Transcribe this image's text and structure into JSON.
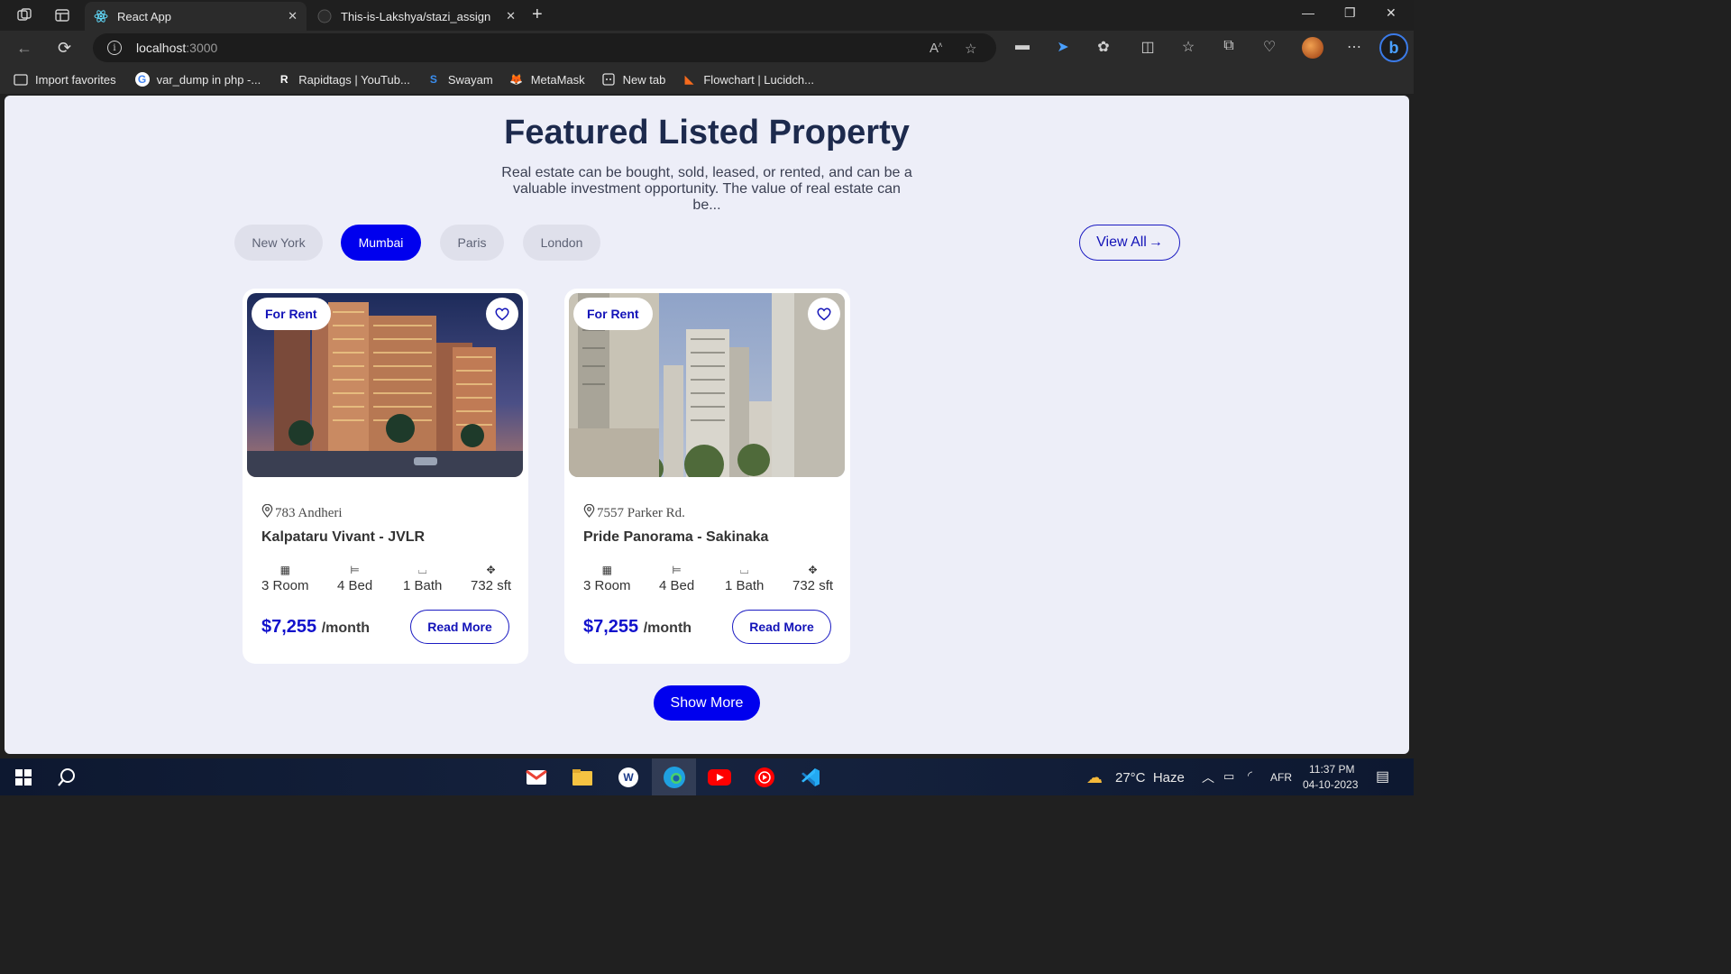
{
  "browser": {
    "tabs": [
      {
        "title": "React App"
      },
      {
        "title": "This-is-Lakshya/stazi_assign"
      }
    ],
    "url_host": "localhost",
    "url_port": ":3000",
    "favorites": [
      {
        "label": "Import favorites",
        "icon": "folder-icon"
      },
      {
        "label": "var_dump in php -...",
        "icon": "google-icon"
      },
      {
        "label": "Rapidtags | YouTub...",
        "icon": "rapidtags-icon"
      },
      {
        "label": "Swayam",
        "icon": "swayam-icon"
      },
      {
        "label": "MetaMask",
        "icon": "metamask-icon"
      },
      {
        "label": "New tab",
        "icon": "newtab-icon"
      },
      {
        "label": "Flowchart | Lucidch...",
        "icon": "lucid-icon"
      }
    ]
  },
  "page": {
    "title": "Featured Listed Property",
    "subtitle": "Real estate can be bought, sold, leased, or rented, and can be a valuable investment opportunity. The value of real estate can be...",
    "cities": [
      "New York",
      "Mumbai",
      "Paris",
      "London"
    ],
    "active_city": "Mumbai",
    "view_all": "View All",
    "show_more": "Show More",
    "listings": [
      {
        "tag": "For Rent",
        "address": "783 Andheri",
        "name": "Kalpataru Vivant - JVLR",
        "rooms": "3 Room",
        "beds": "4 Bed",
        "baths": "1 Bath",
        "area": "732 sft",
        "price": "$7,255",
        "per": "/month",
        "cta": "Read More"
      },
      {
        "tag": "For Rent",
        "address": "7557 Parker Rd.",
        "name": "Pride Panorama - Sakinaka",
        "rooms": "3 Room",
        "beds": "4 Bed",
        "baths": "1 Bath",
        "area": "732 sft",
        "price": "$7,255",
        "per": "/month",
        "cta": "Read More"
      }
    ]
  },
  "taskbar": {
    "weather": "27°C  Haze",
    "lang": "AFR",
    "time": "11:37 PM",
    "date": "04-10-2023"
  },
  "colors": {
    "accent": "#0000ee",
    "title": "#1d2a4d",
    "page_bg": "#edeef8"
  }
}
